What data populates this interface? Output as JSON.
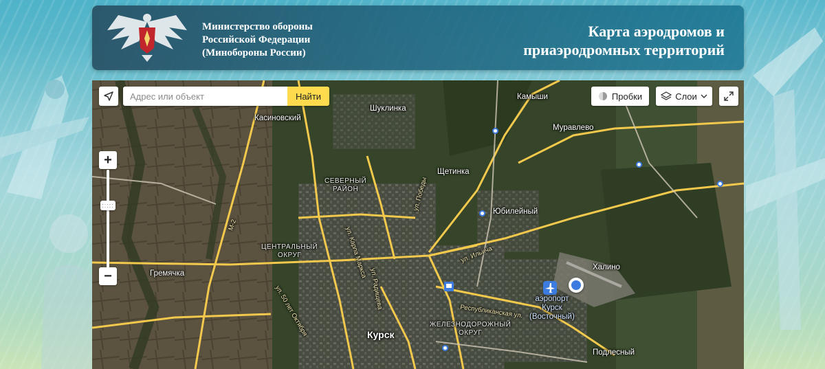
{
  "header": {
    "org_name_line1": "Министерство обороны",
    "org_name_line2": "Российской Федерации",
    "org_name_line3": "(Минобороны России)",
    "title_line1": "Карта аэродромов и",
    "title_line2": "приаэродромных территорий"
  },
  "map": {
    "search": {
      "placeholder": "Адрес или объект",
      "value": "",
      "button_label": "Найти"
    },
    "controls": {
      "traffic_label": "Пробки",
      "layers_label": "Слои",
      "zoom_in": "+",
      "zoom_out": "−",
      "zoom_handle": ":::::"
    },
    "labels": {
      "shuklinka": "Шуклинка",
      "kamyshi": "Камыши",
      "kasinovsky": "Касиновский",
      "muravlevo": "Муравлево",
      "severny_1": "СЕВЕРНЫЙ",
      "severny_2": "РАЙОН",
      "shchetinka": "Щетинка",
      "yubileyny": "Юбилейный",
      "m2": "М-2",
      "central_1": "ЦЕНТРАЛЬНЫЙ",
      "central_2": "ОКРУГ",
      "khalino": "Халино",
      "gremyachka": "Гремячка",
      "airport_1": "аэропорт",
      "airport_2": "Курск",
      "airport_3": "(Восточный)",
      "railway_1": "ЖЕЛЕЗНОДОРОЖНЫЙ",
      "railway_2": "ОКРУГ",
      "kursk": "Курск",
      "podlesny": "Подлесный",
      "ul_ilyicha": "ул. Ильича",
      "ul_respublikanskaya": "Республиканская ул.",
      "ul_karla_marksa": "ул. Карла Маркса",
      "ul_radishcheva": "ул. Радищева",
      "ul_50_let_oktyabrya": "ул. 50 лет Октября",
      "ul_pobedy": "ул. Победы"
    }
  },
  "colors": {
    "search_button": "#ffdb4d",
    "road": "#f2c94c",
    "marker": "#3c7be0"
  }
}
